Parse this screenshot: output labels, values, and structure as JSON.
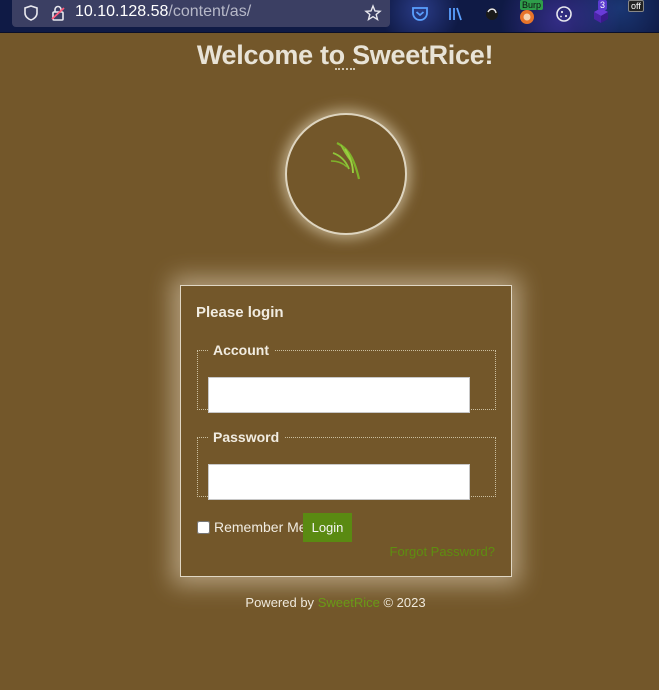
{
  "browser": {
    "url_host": "10.10.128.58",
    "url_path": "/content/as/",
    "icons": [
      "shield-icon",
      "lock-icon",
      "bookmark-star-icon",
      "pocket-icon",
      "library-icon",
      "extension-icon",
      "burp-icon",
      "cookie-icon",
      "extension-badge-icon",
      "toggle-off-icon"
    ],
    "burp_badge": "Burp",
    "count_badge": "3",
    "off_badge": "off"
  },
  "page": {
    "title": "Welcome to SweetRice!"
  },
  "login": {
    "heading": "Please login",
    "account_legend": "Account",
    "account_value": "",
    "password_legend": "Password",
    "password_value": "",
    "remember_label": "Remember Me",
    "login_button": "Login",
    "forgot_link": "Forgot Password?"
  },
  "footer": {
    "prefix": "Powered by",
    "brand": "SweetRice",
    "suffix": "© 2023"
  },
  "colors": {
    "background": "#73572a",
    "accent_green": "#5a8a12",
    "text_light": "#f1ece1"
  }
}
